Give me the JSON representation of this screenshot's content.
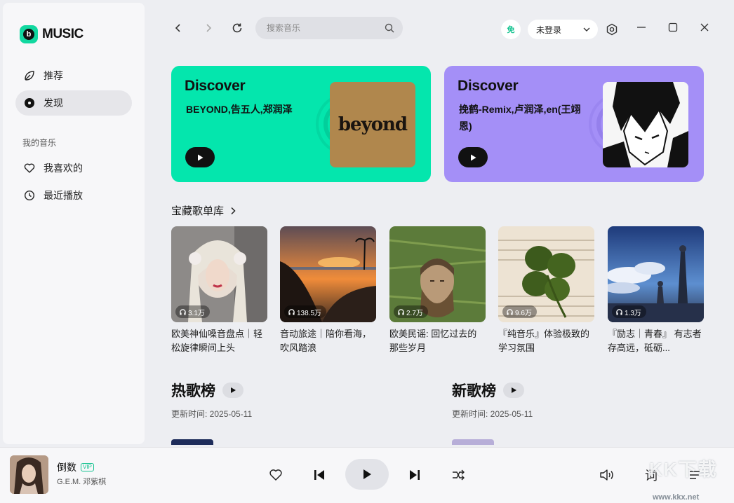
{
  "app": {
    "brand": "MUSIC"
  },
  "sidebar": {
    "items": [
      {
        "label": "推荐",
        "icon": "leaf-icon"
      },
      {
        "label": "发现",
        "icon": "disc-icon"
      }
    ],
    "section_label": "我的音乐",
    "my_items": [
      {
        "label": "我喜欢的",
        "icon": "heart-icon"
      },
      {
        "label": "最近播放",
        "icon": "clock-icon"
      }
    ]
  },
  "topbar": {
    "search_placeholder": "搜索音乐",
    "free_badge": "免",
    "login_label": "未登录"
  },
  "discover": [
    {
      "title": "Discover",
      "artists": "BEYOND,告五人,郑润泽",
      "cover_text": "beyond",
      "color": "#04e6ad"
    },
    {
      "title": "Discover",
      "artists": "挽鹤-Remix,卢润泽,en(王翊恩)",
      "color": "#a48ff7"
    }
  ],
  "playlists_section": {
    "title": "宝藏歌单库"
  },
  "playlists": [
    {
      "count": "3.1万",
      "title": "欧美神仙嗓音盘点｜轻松旋律瞬间上头"
    },
    {
      "count": "138.5万",
      "title": "音动旅途｜陪你看海，吹风踏浪"
    },
    {
      "count": "2.7万",
      "title": "欧美民谣: 回忆过去的那些岁月"
    },
    {
      "count": "9.6万",
      "title": "『纯音乐』体验极致的学习氛围"
    },
    {
      "count": "1.3万",
      "title": "『励志｜青春』 有志者存高远，砥砺..."
    }
  ],
  "charts": [
    {
      "title": "热歌榜",
      "updated": "更新时间: 2025-05-11"
    },
    {
      "title": "新歌榜",
      "updated": "更新时间: 2025-05-11"
    }
  ],
  "player": {
    "song": "倒数",
    "vip": "VIP",
    "artist": "G.E.M. 邓紫棋",
    "lyrics_label": "词"
  },
  "watermark": {
    "text": "KK下载",
    "url": "www.kkx.net"
  }
}
